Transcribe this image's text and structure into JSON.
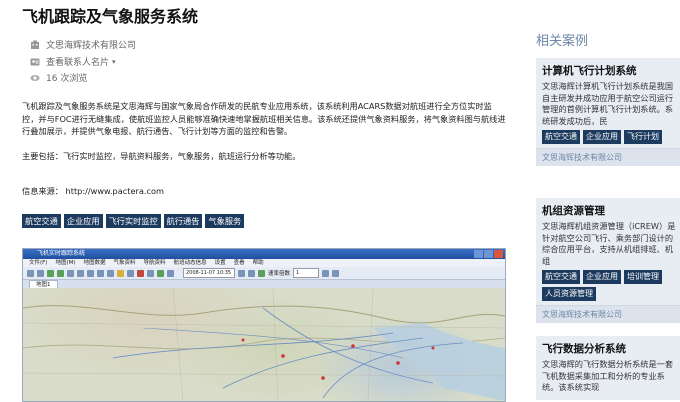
{
  "article": {
    "title": "飞机跟踪及气象服务系统",
    "company": "文思海辉技术有限公司",
    "contact": "查看联系人名片",
    "views": "16 次浏览",
    "description": "飞机跟踪及气象服务系统是文思海辉与国家气象局合作研发的民航专业应用系统，该系统利用ACARS数据对航班进行全方位实时监控，并与FOC进行无缝集成，使航班监控人员能够准确快速地掌握航班相关信息。该系统还提供气象资料服务，将气象资料图与航线进行叠加展示，并提供气象电报、航行通告、飞行计划等方面的监控和告警。",
    "main_features": "主要包括：飞行实时监控，导航资料服务，气象服务，航班运行分析等功能。",
    "source": "信息来源：  http://www.pactera.com",
    "tags": [
      "航空交通",
      "企业应用",
      "飞行实时监控",
      "航行通告",
      "气象服务"
    ]
  },
  "app_screenshot": {
    "window_title": "飞机实时跟踪系统",
    "menu": [
      "文件(F)",
      "地图(M)",
      "地图数据",
      "气象资料",
      "导航资料",
      "航班动态信息",
      "设置",
      "查看",
      "帮助"
    ],
    "time_value": "2008-11-07 10:35",
    "rate_label": "速率倍数",
    "rate_value": "1",
    "tab_label": "地图1"
  },
  "sidebar": {
    "heading": "相关案例",
    "cards": [
      {
        "title": "计算机飞行计划系统",
        "description": "文思海辉计算机飞行计划系统是我国自主研发并成功应用于航空公司运行管理的首例计算机飞行计划系统。系统研发成功后，民",
        "tags": [
          "航空交通",
          "企业应用",
          "飞行计划"
        ],
        "company": "文思海辉技术有限公司"
      },
      {
        "title": "机组资源管理",
        "description": "文思海辉机组资源管理（iCREW）是针对航空公司飞行、乘务部门设计的综合应用平台，支持从机组排班、机组",
        "tags": [
          "航空交通",
          "企业应用",
          "培训管理",
          "人员资源管理"
        ],
        "company": "文思海辉技术有限公司"
      },
      {
        "title": "飞行数据分析系统",
        "description": "文思海辉的飞行数据分析系统是一套飞机数据采集加工和分析的专业系统。该系统实现",
        "tags": [],
        "company": ""
      }
    ]
  }
}
